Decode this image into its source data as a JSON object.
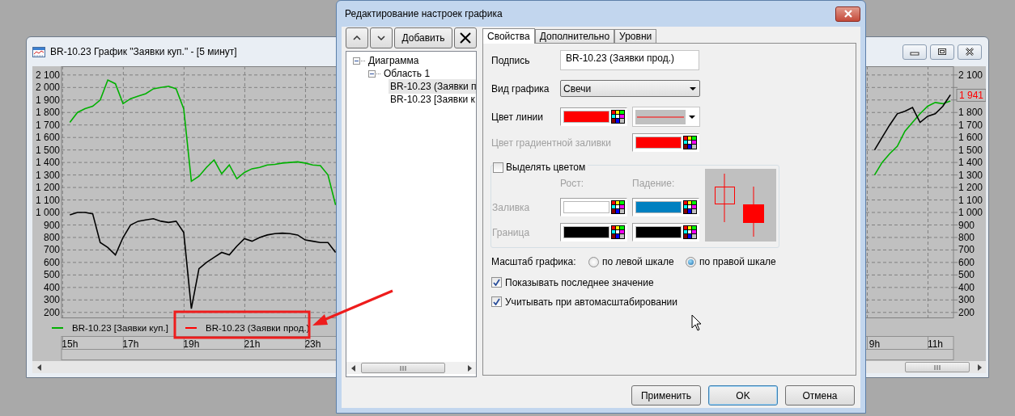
{
  "chart_window": {
    "title": "BR-10.23 График \"Заявки куп.\" - [5 минут]",
    "chart": {
      "chart_data": {
        "type": "line",
        "categories": [
          "15h",
          null,
          null,
          null,
          null,
          null,
          null,
          null,
          "17h",
          null,
          null,
          null,
          null,
          null,
          null,
          null,
          "19h",
          null,
          null,
          null,
          null,
          null,
          null,
          null,
          "21h",
          null,
          null,
          null,
          null,
          null,
          null,
          null,
          "23h",
          null,
          null,
          null,
          null,
          null,
          null,
          null,
          null,
          null,
          null,
          null,
          null,
          null,
          null,
          null,
          null,
          null,
          null,
          null,
          null,
          null,
          null,
          null,
          null,
          null,
          null,
          null,
          null,
          null,
          null,
          null,
          null,
          null,
          null,
          null,
          null,
          null,
          null,
          null,
          null,
          null,
          null,
          null,
          null,
          null,
          null,
          null,
          null,
          null,
          null,
          null,
          null,
          null,
          null,
          null,
          null,
          null,
          null,
          null,
          null,
          null,
          null,
          null,
          null,
          null,
          null,
          null,
          null,
          null,
          null,
          null,
          null,
          null,
          "9h",
          null,
          null,
          null,
          null,
          null,
          null,
          null,
          "11h",
          null,
          null
        ],
        "series": [
          {
            "name": "BR-10.23 [Заявки куп.]",
            "color": "#00b000",
            "values": [
              1720,
              1800,
              1830,
              1850,
              1900,
              2060,
              2030,
              1870,
              1910,
              1930,
              1950,
              1990,
              2000,
              2010,
              1990,
              1830,
              1250,
              1290,
              1360,
              1420,
              1310,
              1380,
              1270,
              1320,
              1350,
              1360,
              1380,
              1385,
              1395,
              1400,
              1405,
              1395,
              1380,
              1375,
              1300,
              1060,
              null,
              null,
              null,
              null,
              null,
              null,
              null,
              null,
              null,
              null,
              null,
              null,
              null,
              null,
              null,
              null,
              null,
              null,
              null,
              null,
              null,
              null,
              null,
              null,
              null,
              null,
              null,
              null,
              null,
              null,
              null,
              null,
              null,
              null,
              null,
              null,
              null,
              null,
              null,
              null,
              null,
              null,
              null,
              null,
              null,
              null,
              null,
              null,
              null,
              null,
              null,
              null,
              null,
              null,
              null,
              null,
              null,
              null,
              null,
              null,
              null,
              null,
              null,
              null,
              null,
              null,
              null,
              null,
              null,
              null,
              1300,
              1400,
              1470,
              1530,
              1650,
              1720,
              1790,
              1850,
              1880,
              1870,
              1892
            ]
          },
          {
            "name": "BR-10.23 (Заявки прод.)",
            "color": "#000000",
            "values": [
              980,
              1000,
              1000,
              990,
              760,
              720,
              660,
              800,
              900,
              930,
              940,
              950,
              930,
              920,
              930,
              840,
              230,
              550,
              600,
              640,
              680,
              660,
              730,
              790,
              770,
              800,
              820,
              830,
              835,
              830,
              820,
              780,
              770,
              760,
              760,
              680,
              null,
              null,
              null,
              null,
              null,
              null,
              null,
              null,
              null,
              null,
              null,
              null,
              null,
              null,
              null,
              null,
              null,
              null,
              null,
              null,
              null,
              null,
              null,
              null,
              null,
              null,
              null,
              null,
              null,
              null,
              null,
              null,
              null,
              null,
              null,
              null,
              null,
              null,
              null,
              null,
              null,
              null,
              null,
              null,
              null,
              null,
              null,
              null,
              null,
              null,
              null,
              null,
              null,
              null,
              null,
              null,
              null,
              null,
              null,
              null,
              null,
              null,
              null,
              null,
              null,
              null,
              null,
              null,
              null,
              null,
              1500,
              1600,
              1700,
              1790,
              1810,
              1840,
              1720,
              1770,
              1790,
              1850,
              1941
            ]
          }
        ],
        "ylim": [
          160,
          2170
        ],
        "grid": true,
        "yticks": [
          {
            "value": 200,
            "label": "200"
          },
          {
            "value": 300,
            "label": "300"
          },
          {
            "value": 400,
            "label": "400"
          },
          {
            "value": 500,
            "label": "500"
          },
          {
            "value": 600,
            "label": "600"
          },
          {
            "value": 700,
            "label": "700"
          },
          {
            "value": 800,
            "label": "800"
          },
          {
            "value": 900,
            "label": "900"
          },
          {
            "value": 1000,
            "label": "1 000"
          },
          {
            "value": 1100,
            "label": "1 100"
          },
          {
            "value": 1200,
            "label": "1 200"
          },
          {
            "value": 1300,
            "label": "1 300"
          },
          {
            "value": 1400,
            "label": "1 400"
          },
          {
            "value": 1500,
            "label": "1 500"
          },
          {
            "value": 1600,
            "label": "1 600"
          },
          {
            "value": 1700,
            "label": "1 700"
          },
          {
            "value": 1800,
            "label": "1 800"
          },
          {
            "value": 1900,
            "label": "1 900"
          },
          {
            "value": 2000,
            "label": "2 000"
          },
          {
            "value": 2100,
            "label": "2 100"
          }
        ]
      },
      "last_value": {
        "label": "1 941",
        "color": "#ff0000"
      }
    },
    "legend": [
      {
        "color": "#00b000"
      },
      {
        "color": "#ff0000"
      }
    ]
  },
  "dialog": {
    "title": "Редактирование настроек графика",
    "toolbar": [
      {
        "kind": "up"
      },
      {
        "kind": "down"
      },
      {
        "kind": "text",
        "label": "Добавить"
      },
      {
        "kind": "delete"
      }
    ],
    "tree": [
      {
        "label": "Диаграмма",
        "expanded": true,
        "children": [
          {
            "label": "Область 1",
            "expanded": true,
            "children": [
              {
                "label": "BR-10.23 (Заявки п",
                "selected": true
              },
              {
                "label": "BR-10.23 [Заявки к",
                "selected": false
              }
            ]
          }
        ]
      }
    ],
    "tabs": [
      {
        "label": "Свойства",
        "selected": true
      },
      {
        "label": "Дополнительно",
        "selected": false
      },
      {
        "label": "Уровни",
        "selected": false
      }
    ],
    "caption": {
      "label": "Подпись",
      "value": "BR-10.23 (Заявки прод.)"
    },
    "chart_type": {
      "label": "Вид графика",
      "value": "Свечи"
    },
    "line_color": {
      "label": "Цвет линии",
      "color": "#ff0000"
    },
    "gradient_color": {
      "label": "Цвет градиентной заливки",
      "color": "#ff0000",
      "disabled": true
    },
    "highlight": {
      "label": "Выделять цветом",
      "checked": false,
      "columns": [
        "Рост:",
        "Падение:"
      ],
      "rows": [
        {
          "label": "Заливка",
          "swatches": [
            {
              "color": "#ffffff"
            },
            {
              "color": "#0080c0"
            }
          ]
        },
        {
          "label": "Граница",
          "swatches": [
            {
              "color": "#000000"
            },
            {
              "color": "#000000"
            }
          ]
        }
      ]
    },
    "scale": {
      "label": "Масштаб графика:",
      "options": [
        {
          "label": "по левой шкале",
          "selected": false
        },
        {
          "label": "по правой шкале",
          "selected": true
        }
      ]
    },
    "options": [
      {
        "label": "Показывать последнее значение",
        "checked": true
      },
      {
        "label": "Учитывать при автомасштабировании",
        "checked": true
      }
    ],
    "buttons": [
      {
        "label": "Применить",
        "default": false
      },
      {
        "label": "OK",
        "default": true
      },
      {
        "label": "Отмена",
        "default": false
      }
    ]
  }
}
